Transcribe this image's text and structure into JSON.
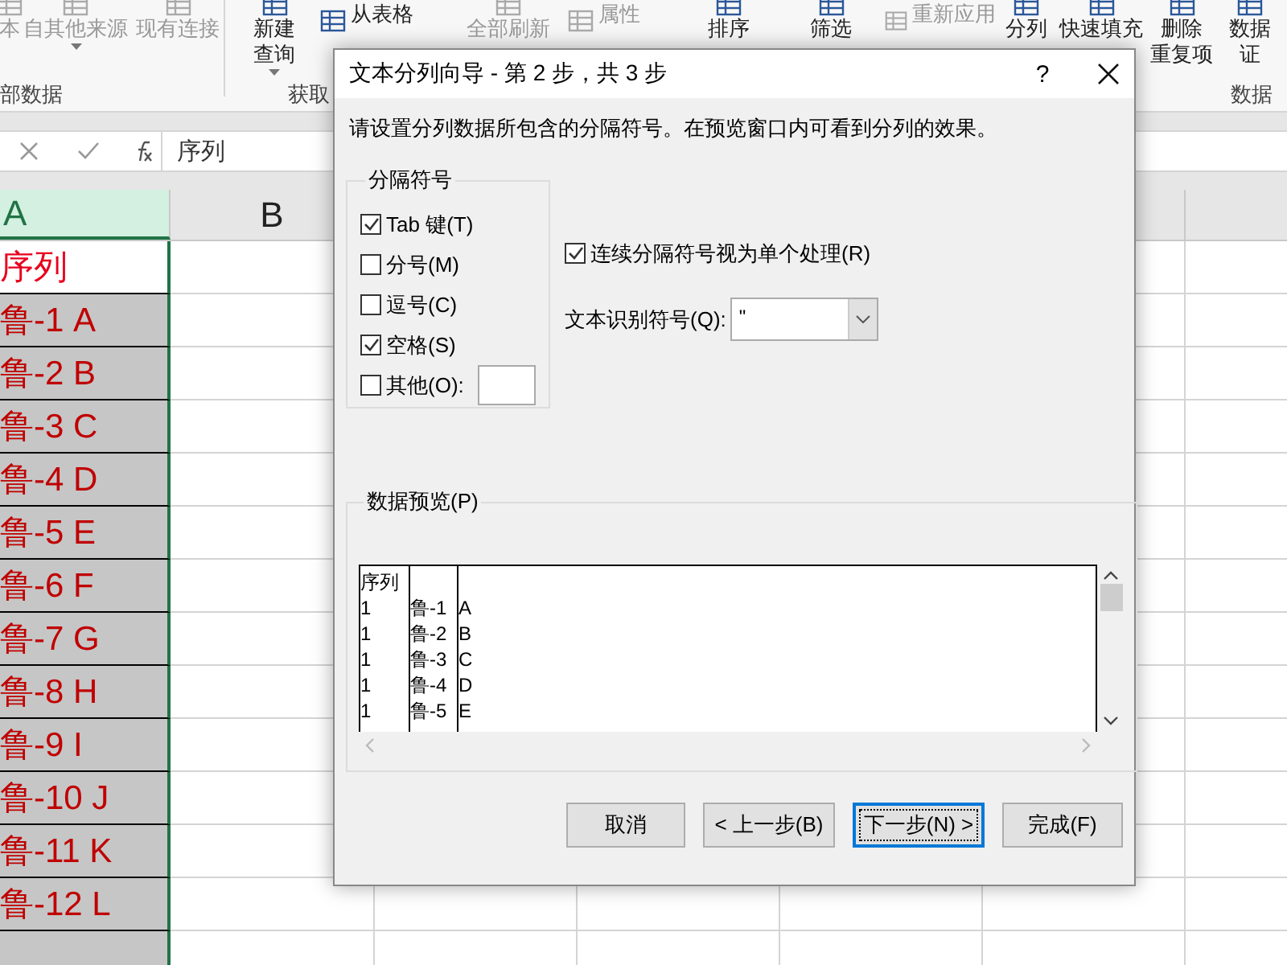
{
  "ribbon": {
    "items": [
      {
        "lines": [
          "本"
        ],
        "kind": "large",
        "disabled": true
      },
      {
        "lines": [
          "自其他来源"
        ],
        "kind": "dropdown",
        "disabled": true
      },
      {
        "lines": [
          "现有连接"
        ],
        "kind": "large",
        "disabled": true
      },
      {
        "lines": [
          "新建",
          "查询"
        ],
        "kind": "dropdown",
        "disabled": false
      },
      {
        "lines": [
          "从表格"
        ],
        "kind": "small",
        "disabled": false
      },
      {
        "lines": [
          "全部刷新"
        ],
        "kind": "large",
        "disabled": true
      },
      {
        "lines": [
          "属性"
        ],
        "kind": "small",
        "disabled": true
      },
      {
        "lines": [
          "排序"
        ],
        "kind": "large",
        "disabled": false
      },
      {
        "lines": [
          "筛选"
        ],
        "kind": "large",
        "disabled": false
      },
      {
        "lines": [
          "重新应用"
        ],
        "kind": "small",
        "disabled": true
      },
      {
        "lines": [
          "分列"
        ],
        "kind": "large",
        "disabled": false
      },
      {
        "lines": [
          "快速填充"
        ],
        "kind": "large",
        "disabled": false
      },
      {
        "lines": [
          "删除",
          "重复项"
        ],
        "kind": "large",
        "disabled": false
      },
      {
        "lines": [
          "数据",
          "证"
        ],
        "kind": "large",
        "disabled": false
      }
    ],
    "groups": [
      {
        "label": "部数据"
      },
      {
        "label": "获取"
      },
      {
        "label": "数据"
      }
    ]
  },
  "formula_bar": {
    "value": "序列"
  },
  "sheet": {
    "columns": [
      {
        "label": "A",
        "selected": true
      },
      {
        "label": "B",
        "selected": false
      }
    ],
    "rows": [
      {
        "cell": "序列",
        "active": true
      },
      {
        "cell": "鲁-1 A",
        "active": false
      },
      {
        "cell": "鲁-2 B",
        "active": false
      },
      {
        "cell": "鲁-3 C",
        "active": false
      },
      {
        "cell": "鲁-4 D",
        "active": false
      },
      {
        "cell": "鲁-5 E",
        "active": false
      },
      {
        "cell": "鲁-6 F",
        "active": false
      },
      {
        "cell": "鲁-7 G",
        "active": false
      },
      {
        "cell": "鲁-8 H",
        "active": false
      },
      {
        "cell": "鲁-9 I",
        "active": false
      },
      {
        "cell": "鲁-10 J",
        "active": false
      },
      {
        "cell": "鲁-11 K",
        "active": false
      },
      {
        "cell": "鲁-12 L",
        "active": false
      }
    ]
  },
  "dialog": {
    "title": "文本分列向导 - 第 2 步，共 3 步",
    "help": "?",
    "instruction": "请设置分列数据所包含的分隔符号。在预览窗口内可看到分列的效果。",
    "delimiters": {
      "legend": "分隔符号",
      "options": [
        {
          "label": "Tab 键(T)",
          "checked": true,
          "kind": "plain"
        },
        {
          "label": "分号(M)",
          "checked": false,
          "kind": "plain"
        },
        {
          "label": "逗号(C)",
          "checked": false,
          "kind": "plain"
        },
        {
          "label": "空格(S)",
          "checked": true,
          "kind": "plain"
        },
        {
          "label": "其他(O):",
          "checked": false,
          "kind": "with_field"
        }
      ]
    },
    "consecutive": {
      "label": "连续分隔符号视为单个处理(R)",
      "checked": true
    },
    "text_qualifier": {
      "label": "文本识别符号(Q):",
      "value": "\""
    },
    "preview": {
      "legend": "数据预览(P)",
      "rows": [
        [
          "序列"
        ],
        [
          "1",
          "鲁-1",
          "A"
        ],
        [
          "1",
          "鲁-2",
          "B"
        ],
        [
          "1",
          "鲁-3",
          "C"
        ],
        [
          "1",
          "鲁-4",
          "D"
        ],
        [
          "1",
          "鲁-5",
          "E"
        ]
      ]
    },
    "buttons": [
      {
        "label": "取消",
        "focused": false
      },
      {
        "label": "< 上一步(B)",
        "focused": false
      },
      {
        "label": "下一步(N) >",
        "focused": true
      },
      {
        "label": "完成(F)",
        "focused": false
      }
    ]
  }
}
